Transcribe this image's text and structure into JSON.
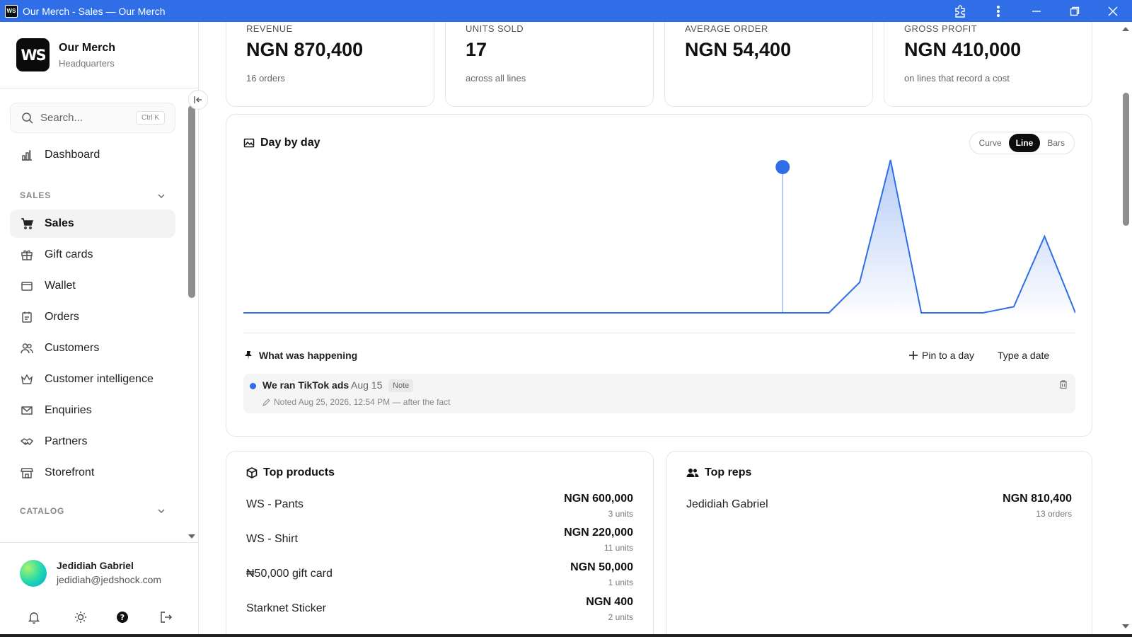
{
  "window": {
    "title": "Our Merch - Sales — Our Merch",
    "logo_text": "WS"
  },
  "sidebar": {
    "brand": {
      "name": "Our Merch",
      "sub": "Headquarters",
      "logo_text": "WS"
    },
    "search": {
      "placeholder": "Search...",
      "shortcut": "Ctrl K"
    },
    "dashboard_label": "Dashboard",
    "sales_section": "SALES",
    "items": [
      {
        "label": "Sales",
        "icon": "cart-icon",
        "active": true
      },
      {
        "label": "Gift cards",
        "icon": "gift-icon"
      },
      {
        "label": "Wallet",
        "icon": "wallet-icon"
      },
      {
        "label": "Orders",
        "icon": "orders-icon"
      },
      {
        "label": "Customers",
        "icon": "users-icon"
      },
      {
        "label": "Customer intelligence",
        "icon": "crown-icon"
      },
      {
        "label": "Enquiries",
        "icon": "mail-icon"
      },
      {
        "label": "Partners",
        "icon": "handshake-icon"
      },
      {
        "label": "Storefront",
        "icon": "store-icon"
      }
    ],
    "catalog_section": "CATALOG",
    "user": {
      "name": "Jedidiah Gabriel",
      "email": "jedidiah@jedshock.com"
    }
  },
  "stats": [
    {
      "label": "REVENUE",
      "value": "NGN 870,400",
      "sub": "16 orders"
    },
    {
      "label": "UNITS SOLD",
      "value": "17",
      "sub": "across all lines"
    },
    {
      "label": "AVERAGE ORDER",
      "value": "NGN 54,400",
      "sub": ""
    },
    {
      "label": "GROSS PROFIT",
      "value": "NGN 410,000",
      "sub": "on lines that record a cost"
    }
  ],
  "chart": {
    "title": "Day by day",
    "modes": [
      "Curve",
      "Line",
      "Bars"
    ],
    "selected_mode": "Line",
    "accent": "#2f6ee6"
  },
  "chart_data": {
    "type": "area",
    "points": [
      0,
      0,
      0,
      0,
      0,
      0,
      0,
      0,
      0,
      0,
      0,
      0,
      0,
      0,
      0,
      0,
      0,
      0,
      0,
      0,
      0.2,
      1.0,
      0,
      0,
      0,
      0.04,
      0.5,
      0
    ],
    "pinned_index": 17.5,
    "ylim": [
      0,
      1
    ]
  },
  "happening": {
    "title": "What was happening",
    "pin_label": "Pin to a day",
    "type_date_label": "Type a date",
    "note": {
      "title": "We ran TikTok ads",
      "date": "Aug 15",
      "tag": "Note",
      "meta": "Noted Aug 25, 2026, 12:54 PM — after the fact"
    }
  },
  "top_products": {
    "title": "Top products",
    "rows": [
      {
        "name": "WS - Pants",
        "amount": "NGN 600,000",
        "sub": "3 units"
      },
      {
        "name": "WS - Shirt",
        "amount": "NGN 220,000",
        "sub": "11 units"
      },
      {
        "name": "₦50,000 gift card",
        "amount": "NGN 50,000",
        "sub": "1 units"
      },
      {
        "name": "Starknet Sticker",
        "amount": "NGN 400",
        "sub": "2 units"
      }
    ]
  },
  "top_reps": {
    "title": "Top reps",
    "rows": [
      {
        "name": "Jedidiah Gabriel",
        "amount": "NGN 810,400",
        "sub": "13 orders"
      }
    ]
  }
}
